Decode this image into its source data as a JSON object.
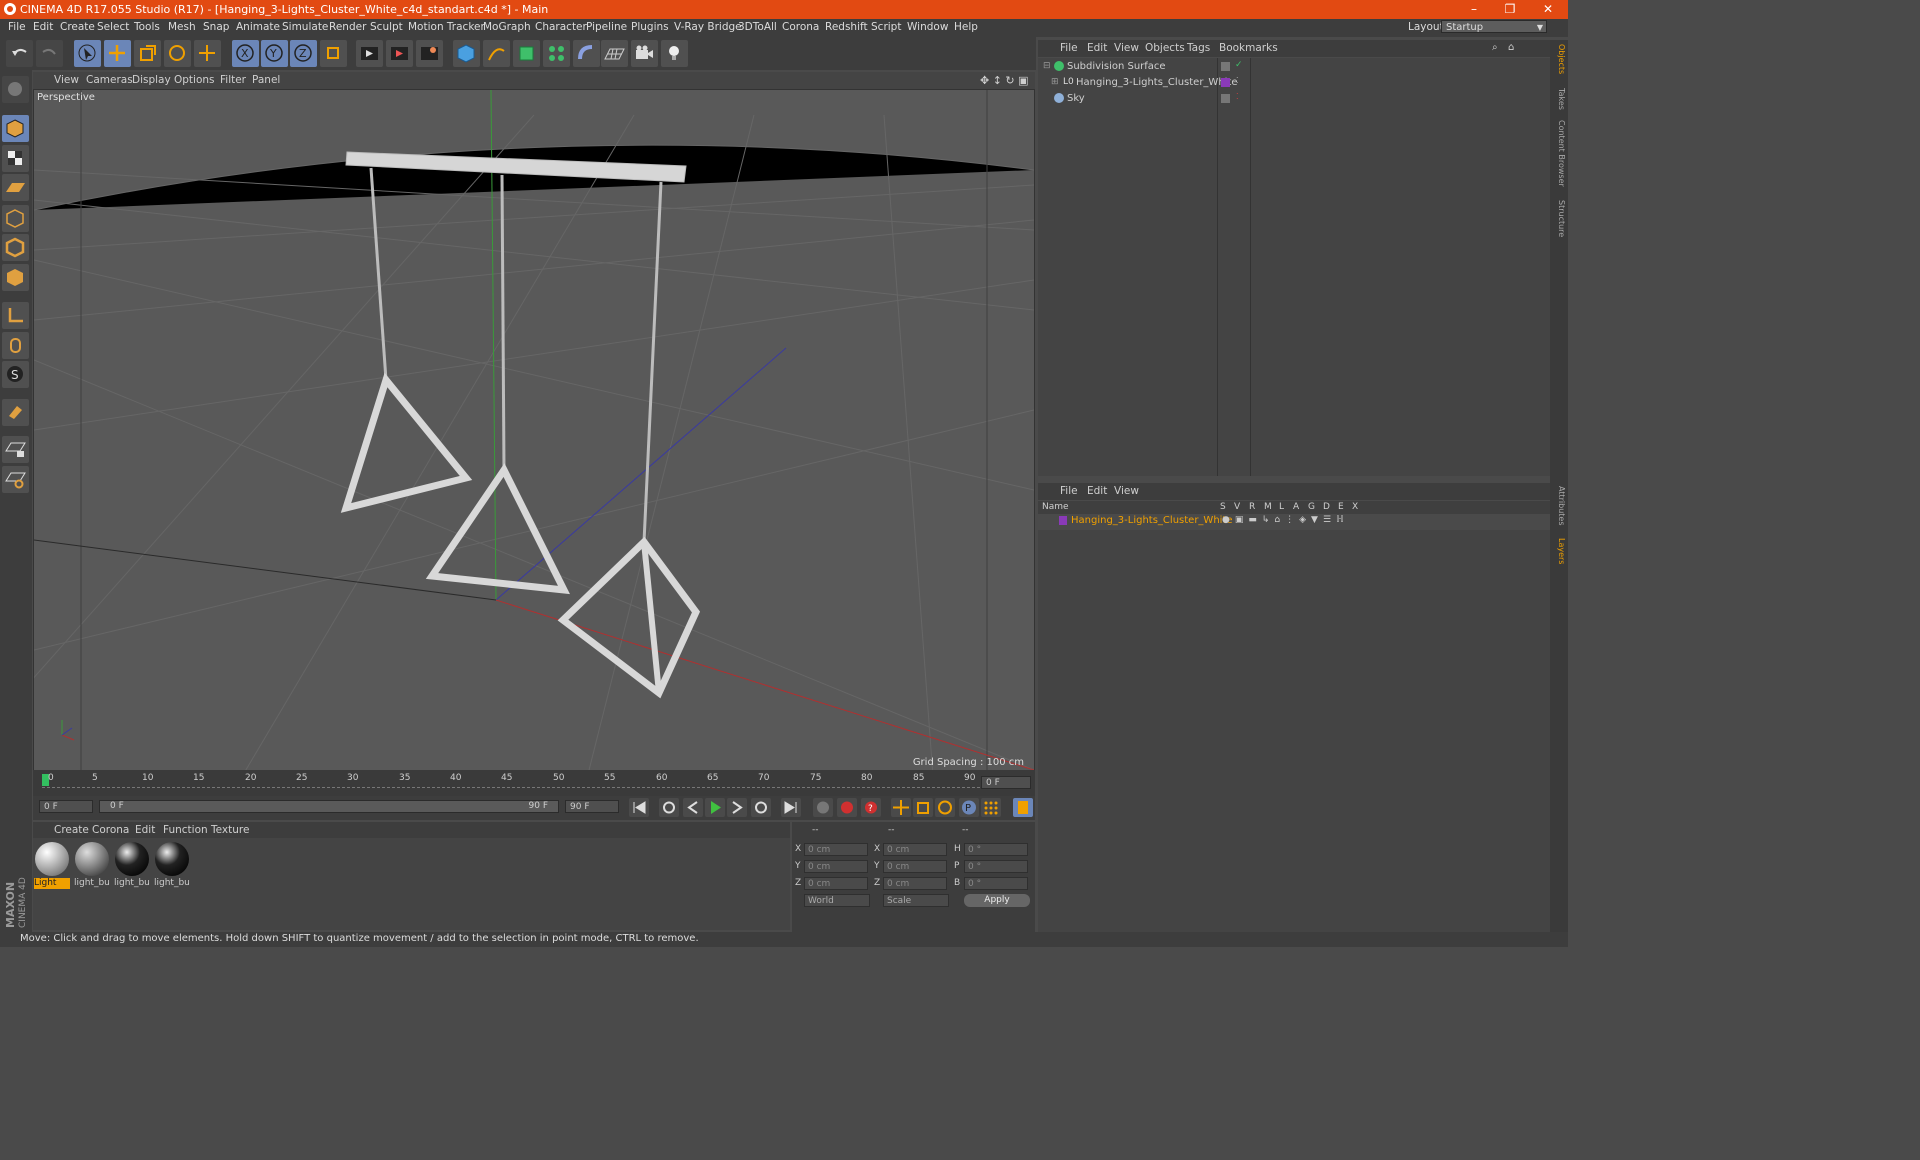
{
  "window": {
    "title": "CINEMA 4D R17.055 Studio (R17) - [Hanging_3-Lights_Cluster_White_c4d_standart.c4d *] - Main",
    "minimize": "–",
    "maximize": "❐",
    "close": "✕"
  },
  "menubar": {
    "items": [
      "File",
      "Edit",
      "Create",
      "Select",
      "Tools",
      "Mesh",
      "Snap",
      "Animate",
      "Simulate",
      "Render",
      "Sculpt",
      "Motion Tracker",
      "MoGraph",
      "Character",
      "Pipeline",
      "Plugins",
      "V-Ray Bridge",
      "3DToAll",
      "Corona",
      "Redshift",
      "Script",
      "Window",
      "Help"
    ],
    "layout_label": "Layout:",
    "layout_value": "Startup"
  },
  "viewport": {
    "menu": [
      "View",
      "Cameras",
      "Display",
      "Options",
      "Filter",
      "Panel"
    ],
    "camera": "Perspective",
    "grid_spacing": "Grid Spacing : 100 cm"
  },
  "timeline": {
    "ticks": [
      "0",
      "5",
      "10",
      "15",
      "20",
      "25",
      "30",
      "35",
      "40",
      "45",
      "50",
      "55",
      "60",
      "65",
      "70",
      "75",
      "80",
      "85",
      "90"
    ],
    "frame_display": "0 F",
    "start": "0 F",
    "range_start": "0 F",
    "range_end": "90 F",
    "end": "90 F"
  },
  "materials": {
    "menu": [
      "Create",
      "Corona",
      "Edit",
      "Function",
      "Texture"
    ],
    "items": [
      {
        "name": "Light"
      },
      {
        "name": "light_bu"
      },
      {
        "name": "light_bu"
      },
      {
        "name": "light_bu"
      }
    ]
  },
  "coordinates": {
    "headers": [
      "--",
      "--",
      "--"
    ],
    "rows": [
      {
        "a": "X",
        "av": "0 cm",
        "b": "X",
        "bv": "0 cm",
        "c": "H",
        "cv": "0 °"
      },
      {
        "a": "Y",
        "av": "0 cm",
        "b": "Y",
        "bv": "0 cm",
        "c": "P",
        "cv": "0 °"
      },
      {
        "a": "Z",
        "av": "0 cm",
        "b": "Z",
        "bv": "0 cm",
        "c": "B",
        "cv": "0 °"
      }
    ],
    "mode1": "World",
    "mode2": "Scale",
    "apply": "Apply"
  },
  "status": "Move: Click and drag to move elements. Hold down SHIFT to quantize movement / add to the selection in point mode, CTRL to remove.",
  "objects": {
    "menu": [
      "File",
      "Edit",
      "View",
      "Objects",
      "Tags",
      "Bookmarks"
    ],
    "items": [
      {
        "name": "Subdivision Surface"
      },
      {
        "name": "Hanging_3-Lights_Cluster_White"
      },
      {
        "name": "Sky"
      }
    ]
  },
  "layers": {
    "menu": [
      "File",
      "Edit",
      "View"
    ],
    "columns": [
      "Name",
      "S",
      "V",
      "R",
      "M",
      "L",
      "A",
      "G",
      "D",
      "E",
      "X"
    ],
    "items": [
      {
        "name": "Hanging_3-Lights_Cluster_White"
      }
    ]
  },
  "side_tabs": [
    "Objects",
    "Takes",
    "Content Browser",
    "Structure",
    "Attributes",
    "Layers"
  ],
  "brand": "MAXON CINEMA 4D"
}
